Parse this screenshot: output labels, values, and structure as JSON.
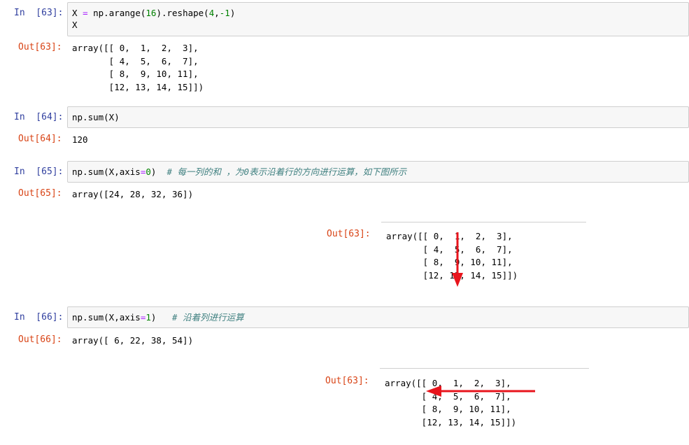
{
  "cells": [
    {
      "in_prompt": "In  [63]:",
      "code_lines": [
        [
          {
            "t": "X ",
            "c": ""
          },
          {
            "t": "=",
            "c": "op"
          },
          {
            "t": " np.arange(",
            "c": ""
          },
          {
            "t": "16",
            "c": "num"
          },
          {
            "t": ").reshape(",
            "c": ""
          },
          {
            "t": "4",
            "c": "num"
          },
          {
            "t": ",",
            "c": ""
          },
          {
            "t": "-1",
            "c": "num"
          },
          {
            "t": ")",
            "c": ""
          }
        ],
        [
          {
            "t": "X",
            "c": ""
          }
        ]
      ],
      "out_prompt": "Out[63]:",
      "out_lines": [
        "array([[ 0,  1,  2,  3],",
        "       [ 4,  5,  6,  7],",
        "       [ 8,  9, 10, 11],",
        "       [12, 13, 14, 15]])"
      ]
    },
    {
      "in_prompt": "In  [64]:",
      "code_lines": [
        [
          {
            "t": "np.sum(X)",
            "c": ""
          }
        ]
      ],
      "out_prompt": "Out[64]:",
      "out_lines": [
        "120"
      ]
    },
    {
      "in_prompt": "In  [65]:",
      "code_lines": [
        [
          {
            "t": "np.sum(X,axis",
            "c": ""
          },
          {
            "t": "=",
            "c": "op"
          },
          {
            "t": "0",
            "c": "num"
          },
          {
            "t": ")  ",
            "c": ""
          },
          {
            "t": "# 每一列的和 ，为0表示沿着行的方向进行运算，如下图所示",
            "c": "comment"
          }
        ]
      ],
      "out_prompt": "Out[65]:",
      "out_lines": [
        "array([24, 28, 32, 36])"
      ]
    },
    {
      "in_prompt": "In  [66]:",
      "code_lines": [
        [
          {
            "t": "np.sum(X,axis",
            "c": ""
          },
          {
            "t": "=",
            "c": "op"
          },
          {
            "t": "1",
            "c": "num"
          },
          {
            "t": ")   ",
            "c": ""
          },
          {
            "t": "# 沿着列进行运算",
            "c": "comment"
          }
        ]
      ],
      "out_prompt": "Out[66]:",
      "out_lines": [
        "array([ 6, 22, 38, 54])"
      ]
    }
  ],
  "illustrations": [
    {
      "out_prompt": "Out[63]:",
      "lines": [
        "array([[ 0,  1,  2,  3],",
        "       [ 4,  5,  6,  7],",
        "       [ 8,  9, 10, 11],",
        "       [12, 13, 14, 15]])"
      ],
      "arrow": "down"
    },
    {
      "out_prompt": "Out[63]:",
      "lines": [
        "array([[ 0,  1,  2,  3],",
        "       [ 4,  5,  6,  7],",
        "       [ 8,  9, 10, 11],",
        "       [12, 13, 14, 15]])"
      ],
      "arrow": "left"
    }
  ],
  "colors": {
    "in_prompt": "#303f9f",
    "out_prompt": "#d84315",
    "arrow": "#e8141c",
    "cell_bg": "#f7f7f7"
  }
}
